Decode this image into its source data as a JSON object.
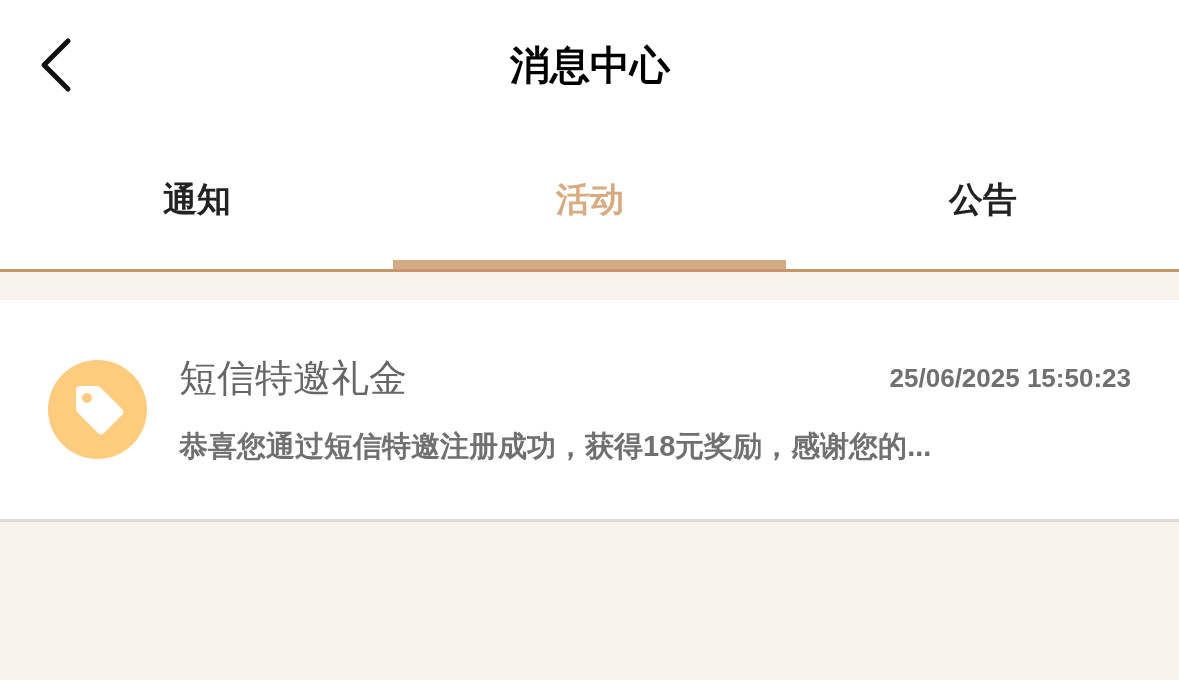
{
  "header": {
    "title": "消息中心"
  },
  "tabs": [
    {
      "label": "通知",
      "selected": false
    },
    {
      "label": "活动",
      "selected": true
    },
    {
      "label": "公告",
      "selected": false
    }
  ],
  "messages": [
    {
      "title": "短信特邀礼金",
      "time": "25/06/2025 15:50:23",
      "preview": "恭喜您通过短信特邀注册成功，获得18元奖励，感谢您的..."
    }
  ]
}
